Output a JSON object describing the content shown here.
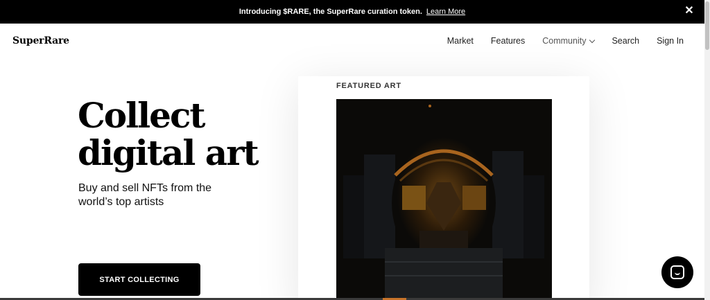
{
  "announcement": {
    "text": "Introducing $RARE, the SuperRare curation token.",
    "link": "Learn More",
    "close": "✕"
  },
  "header": {
    "logo": "SuperRare",
    "nav": [
      {
        "label": "Market"
      },
      {
        "label": "Features"
      },
      {
        "label": "Community"
      },
      {
        "label": "Search"
      },
      {
        "label": "Sign In"
      }
    ]
  },
  "hero": {
    "title_line1": "Collect",
    "title_line2": "digital art",
    "subtitle": "Buy and sell NFTs from the world’s top artists",
    "cta": "START COLLECTING"
  },
  "featured": {
    "label": "FEATURED ART"
  },
  "icons": {
    "close": "close-icon",
    "chevron": "chevron-down-icon",
    "chat": "chat-icon"
  },
  "colors": {
    "black": "#000000",
    "art_amber": "#8a5a1c",
    "art_dark": "#0b0a08"
  }
}
